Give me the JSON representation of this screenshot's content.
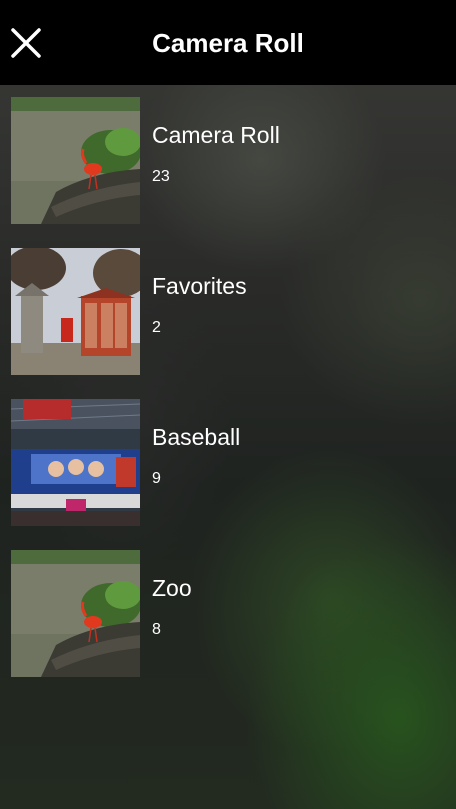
{
  "header": {
    "title": "Camera Roll",
    "close_icon": "close-icon"
  },
  "albums": [
    {
      "name": "Camera Roll",
      "count": "23",
      "thumbnail": "bird-on-rock-photo"
    },
    {
      "name": "Favorites",
      "count": "2",
      "thumbnail": "phone-booth-photo"
    },
    {
      "name": "Baseball",
      "count": "9",
      "thumbnail": "stadium-scoreboard-photo"
    },
    {
      "name": "Zoo",
      "count": "8",
      "thumbnail": "bird-on-rock-photo"
    }
  ],
  "colors": {
    "header_bg": "#000000",
    "text": "#ffffff"
  }
}
